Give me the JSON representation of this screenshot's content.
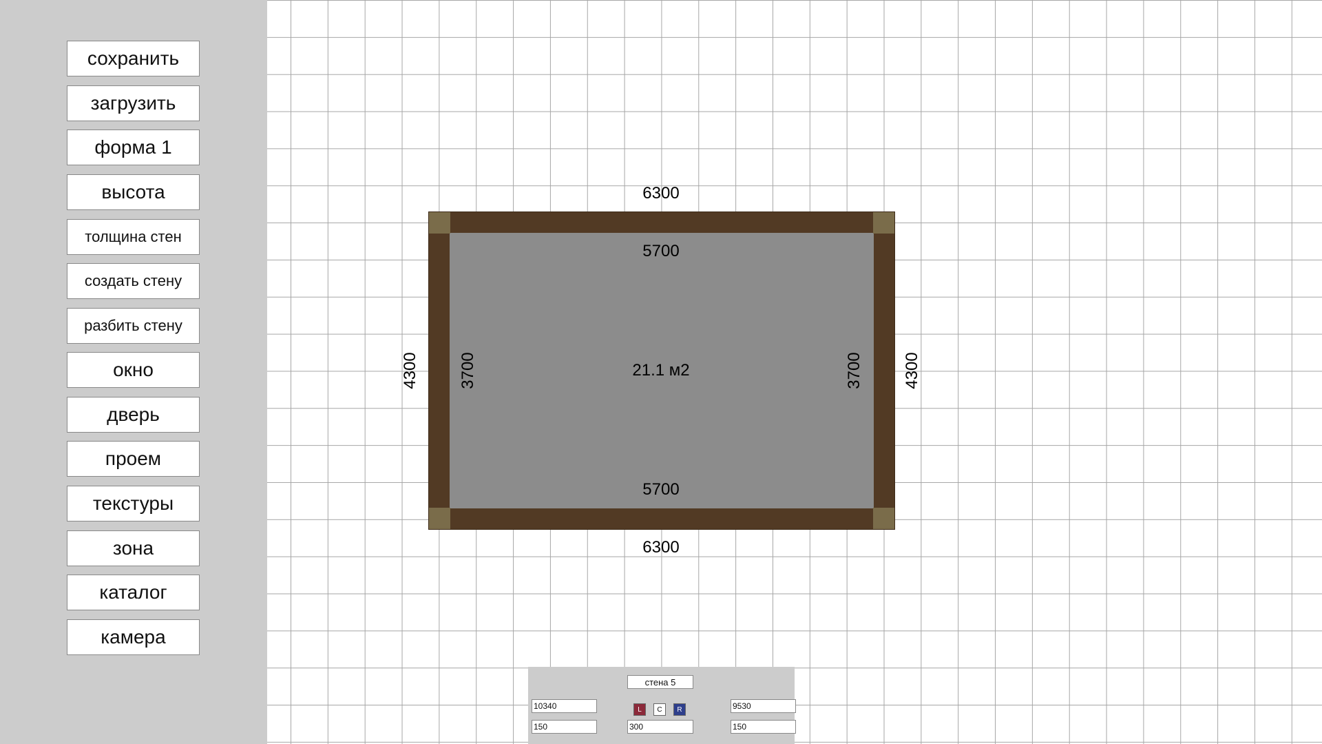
{
  "sidebar": {
    "buttons": [
      {
        "label": "сохранить"
      },
      {
        "label": "загрузить"
      },
      {
        "label": "форма 1"
      },
      {
        "label": "высота"
      },
      {
        "label": "толщина стен"
      },
      {
        "label": "создать стену"
      },
      {
        "label": "разбить стену"
      },
      {
        "label": "окно"
      },
      {
        "label": "дверь"
      },
      {
        "label": "проем"
      },
      {
        "label": "текстуры"
      },
      {
        "label": "зона"
      },
      {
        "label": "каталог"
      },
      {
        "label": "камера"
      }
    ]
  },
  "room": {
    "area": "21.1 м2",
    "outer_top": "6300",
    "outer_bottom": "6300",
    "outer_left": "4300",
    "outer_right": "4300",
    "inner_top": "5700",
    "inner_bottom": "5700",
    "inner_left": "3700",
    "inner_right": "3700",
    "colors": {
      "wall": "#523a24",
      "floor": "#8c8c8c",
      "corner": "#7a6c4a"
    }
  },
  "wall_panel": {
    "name": "стена 5",
    "left_length": "10340",
    "right_length": "9530",
    "left_offset": "150",
    "thickness": "300",
    "right_offset": "150",
    "align_left": "L",
    "align_center": "C",
    "align_right": "R",
    "colors": {
      "align_left_bg": "#8c2a3a",
      "align_center_bg": "#ffffff",
      "align_right_bg": "#2e3f8c"
    }
  }
}
